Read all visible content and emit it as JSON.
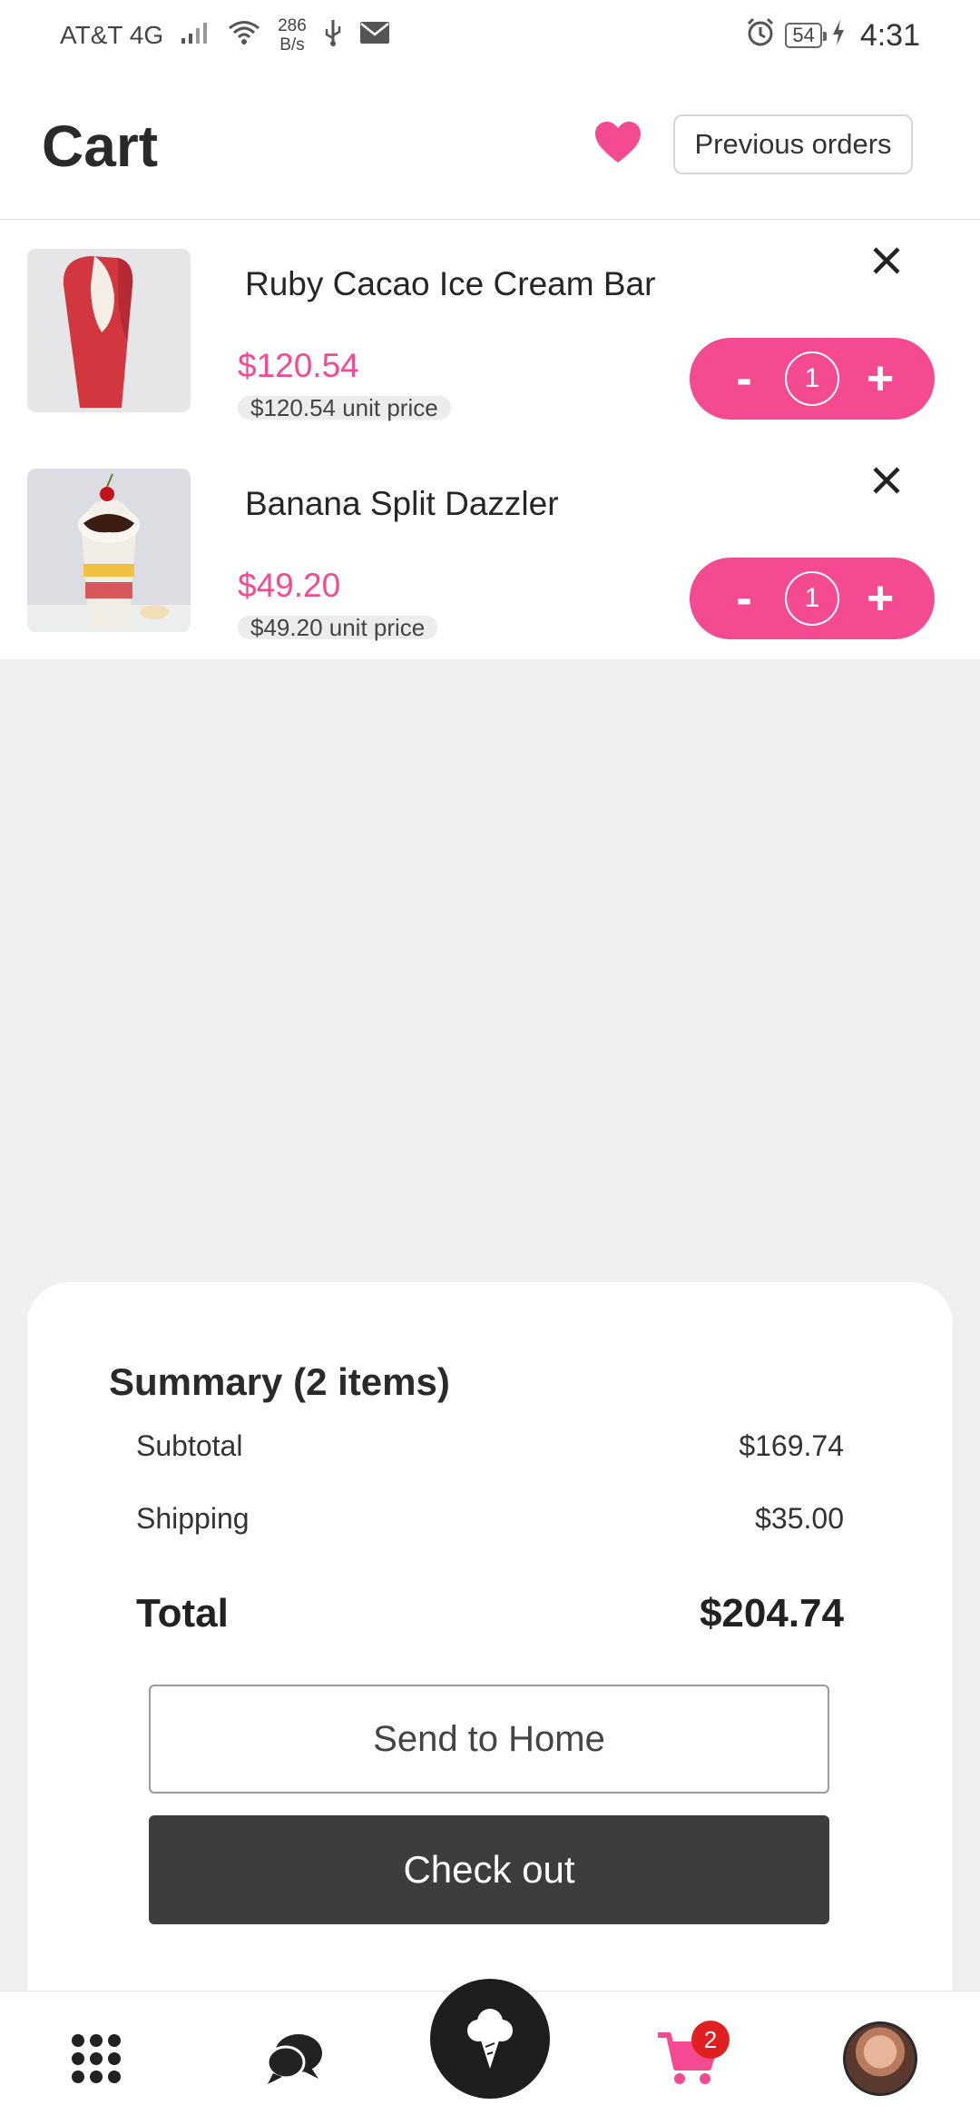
{
  "status_bar": {
    "carrier": "AT&T 4G",
    "net_speed_value": "286",
    "net_speed_unit": "B/s",
    "battery": "54",
    "time": "4:31"
  },
  "header": {
    "title": "Cart",
    "previous_orders_label": "Previous orders"
  },
  "cart": {
    "items": [
      {
        "name": "Ruby Cacao Ice Cream Bar",
        "price": "$120.54",
        "unit_price": "$120.54 unit price",
        "quantity": "1",
        "minus": "-",
        "plus": "+"
      },
      {
        "name": "Banana Split Dazzler",
        "price": "$49.20",
        "unit_price": "$49.20 unit price",
        "quantity": "1",
        "minus": "-",
        "plus": "+"
      }
    ]
  },
  "summary": {
    "title": "Summary (2 items)",
    "subtotal_label": "Subtotal",
    "subtotal_value": "$169.74",
    "shipping_label": "Shipping",
    "shipping_value": "$35.00",
    "total_label": "Total",
    "total_value": "$204.74",
    "send_home_label": "Send to Home",
    "checkout_label": "Check out"
  },
  "bottom_nav": {
    "cart_badge": "2",
    "icons": [
      "grid-menu-icon",
      "chat-icon",
      "ice-cream-icon",
      "cart-icon",
      "profile-avatar"
    ]
  },
  "colors": {
    "accent": "#f44a91",
    "dark_button": "#3d3d3d",
    "badge": "#e02020"
  }
}
